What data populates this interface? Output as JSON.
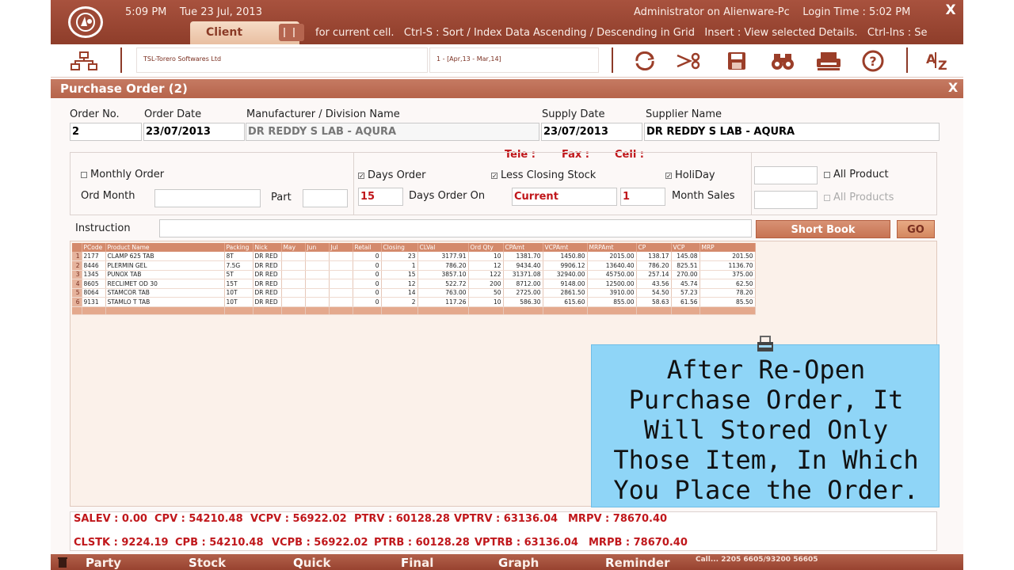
{
  "titlebar": {
    "time": "5:09 PM",
    "date": "Tue 23 Jul, 2013",
    "user": "Administrator on Alienware-Pc",
    "login_time": "Login Time : 5:02 PM",
    "close": "X",
    "client_tab": "Client",
    "shortcut_hint": "for current cell.   Ctrl-S : Sort / Index Data Ascending / Descending in Grid   Insert : View selected Details.   Ctrl-Ins : Se"
  },
  "toolbar": {
    "company": "TSL-Torero Softwares Ltd",
    "period": "1 - [Apr,13 - Mar,14]",
    "icons": [
      "network-icon",
      "refresh-icon",
      "cut-icon",
      "save-icon",
      "binoculars-icon",
      "printer-icon",
      "help-icon",
      "sort-az-icon"
    ]
  },
  "form": {
    "title": "Purchase Order (2)",
    "close": "X",
    "order_no_label": "Order No.",
    "order_no": "2",
    "order_date_label": "Order Date",
    "order_date": "23/07/2013",
    "manufacturer_label": "Manufacturer / Division Name",
    "manufacturer": "DR REDDY S LAB - AQURA",
    "supply_date_label": "Supply Date",
    "supply_date": "23/07/2013",
    "supplier_label": "Supplier Name",
    "supplier": "DR REDDY S LAB - AQURA",
    "tele_label": "Tele :",
    "fax_label": "Fax :",
    "cell_label": "Cell :",
    "monthly_order": "Monthly Order",
    "ord_month_label": "Ord Month",
    "part_label": "Part",
    "days_order": "Days Order",
    "days_value": "15",
    "days_order_on_label": "Days Order On",
    "less_closing_stock": "Less Closing Stock",
    "current_value": "Current",
    "month_value": "1",
    "month_sales_label": "Month Sales",
    "holiday": "HoliDay",
    "all_product": "All Product",
    "all_products": "All Products",
    "instruction_label": "Instruction",
    "short_book": "Short Book",
    "go": "GO"
  },
  "grid": {
    "columns": [
      "PCode",
      "Product Name",
      "Packing",
      "Nick",
      "May",
      "Jun",
      "Jul",
      "Retail",
      "Closing",
      "CLVal",
      "Ord Qty",
      "CPAmt",
      "VCPAmt",
      "MRPAmt",
      "CP",
      "VCP",
      "MRP"
    ],
    "rows": [
      [
        "2177",
        "CLAMP 625 TAB",
        "8T",
        "DR RED",
        "",
        "",
        "",
        "0",
        "23",
        "3177.91",
        "10",
        "1381.70",
        "1450.80",
        "2015.00",
        "138.17",
        "145.08",
        "201.50"
      ],
      [
        "8446",
        "PLERMIN GEL",
        "7.5G",
        "DR RED",
        "",
        "",
        "",
        "0",
        "1",
        "786.20",
        "12",
        "9434.40",
        "9906.12",
        "13640.40",
        "786.20",
        "825.51",
        "1136.70"
      ],
      [
        "1345",
        "PUNOX TAB",
        "5T",
        "DR RED",
        "",
        "",
        "",
        "0",
        "15",
        "3857.10",
        "122",
        "31371.08",
        "32940.00",
        "45750.00",
        "257.14",
        "270.00",
        "375.00"
      ],
      [
        "8605",
        "RECLIMET OD 30",
        "15T",
        "DR RED",
        "",
        "",
        "",
        "0",
        "12",
        "522.72",
        "200",
        "8712.00",
        "9148.00",
        "12500.00",
        "43.56",
        "45.74",
        "62.50"
      ],
      [
        "8064",
        "STAMCOR TAB",
        "10T",
        "DR RED",
        "",
        "",
        "",
        "0",
        "14",
        "763.00",
        "50",
        "2725.00",
        "2861.50",
        "3910.00",
        "54.50",
        "57.23",
        "78.20"
      ],
      [
        "9131",
        "STAMLO T TAB",
        "10T",
        "DR RED",
        "",
        "",
        "",
        "0",
        "2",
        "117.26",
        "10",
        "586.30",
        "615.60",
        "855.00",
        "58.63",
        "61.56",
        "85.50"
      ]
    ]
  },
  "caption": {
    "lines": [
      "After Re-Open",
      "Purchase Order, It",
      "Will Stored Only",
      "Those Item, In Which",
      "You Place the Order."
    ]
  },
  "summary": {
    "row1": [
      "SALEV : 0.00",
      "CPV : 54210.48",
      "VCPV : 56922.02",
      "PTRV : 60128.28",
      "VPTRV : 63136.04",
      "MRPV : 78670.40"
    ],
    "row2": [
      "CLSTK : 9224.19",
      "CPB : 54210.48",
      "VCPB : 56922.02",
      "PTRB : 60128.28",
      "VPTRB : 63136.04",
      "MRPB : 78670.40"
    ]
  },
  "bottomnav": {
    "items": [
      {
        "first": "P",
        "rest": "arty"
      },
      {
        "first": "S",
        "rest": "tock"
      },
      {
        "first": "Q",
        "rest": "uick"
      },
      {
        "first": "F",
        "rest": "inal"
      },
      {
        "first": "G",
        "rest": "raph"
      },
      {
        "first": "R",
        "rest": "eminder"
      }
    ],
    "call": "Call... 2205 6605/93200 56605"
  }
}
